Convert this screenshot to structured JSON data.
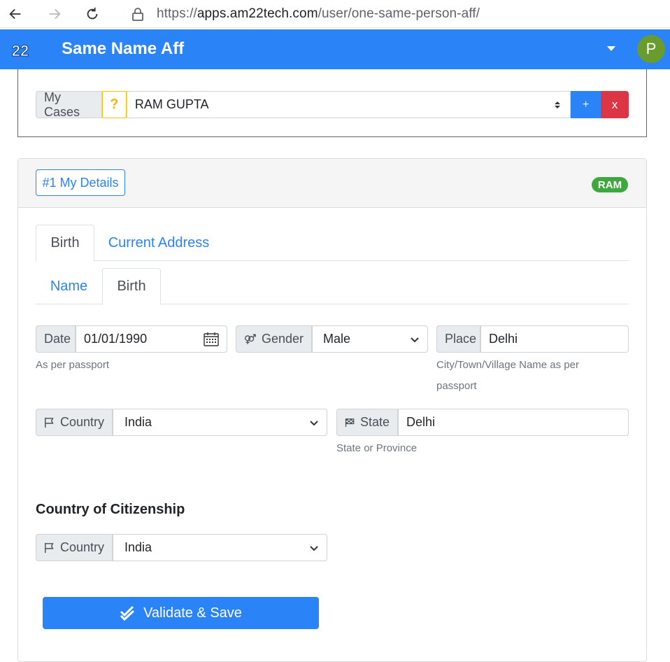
{
  "browser": {
    "url_scheme": "https://",
    "url_host": "apps.am22tech.com",
    "url_path": "/user/one-same-person-aff/"
  },
  "header": {
    "logo_text": "22",
    "title": "Same Name Aff",
    "avatar_letter": "P",
    "brand_color": "#2b83f8"
  },
  "case_bar": {
    "label": "My Cases",
    "help_label": "?",
    "selected_case": "RAM GUPTA",
    "add_label": "+",
    "remove_label": "x"
  },
  "card": {
    "details_button": "#1 My Details",
    "badge": "RAM",
    "outer_tabs": [
      "Birth",
      "Current Address"
    ],
    "inner_tabs": [
      "Name",
      "Birth"
    ]
  },
  "birth": {
    "date_label": "Date",
    "date_value": "01/01/1990",
    "date_help": "As per passport",
    "gender_label": "Gender",
    "gender_value": "Male",
    "place_label": "Place",
    "place_value": "Delhi",
    "place_help": "City/Town/Village Name as per passport",
    "country_label": "Country",
    "country_value": "India",
    "state_label": "State",
    "state_value": "Delhi",
    "state_help": "State or Province"
  },
  "citizenship": {
    "title": "Country of Citizenship",
    "country_label": "Country",
    "country_value": "India"
  },
  "actions": {
    "save_label": "Validate & Save"
  }
}
